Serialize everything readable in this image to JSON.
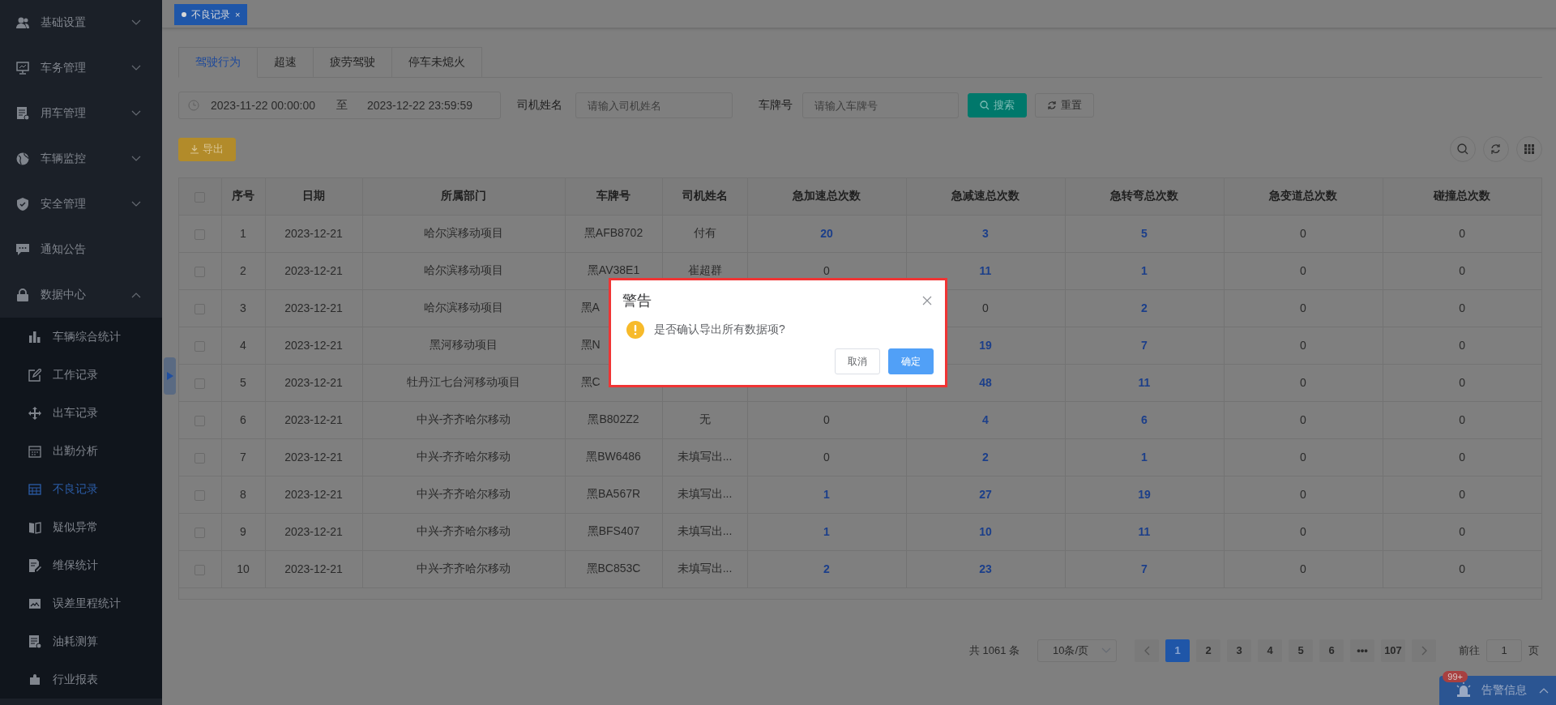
{
  "sidebar": {
    "items": [
      {
        "label": "基础设置",
        "kind": "group",
        "expanded": false
      },
      {
        "label": "车务管理",
        "kind": "group",
        "expanded": false
      },
      {
        "label": "用车管理",
        "kind": "group",
        "expanded": false
      },
      {
        "label": "车辆监控",
        "kind": "group",
        "expanded": false
      },
      {
        "label": "安全管理",
        "kind": "group",
        "expanded": false
      },
      {
        "label": "通知公告",
        "kind": "link"
      },
      {
        "label": "数据中心",
        "kind": "group",
        "expanded": true,
        "children": [
          {
            "label": "车辆综合统计",
            "selected": false
          },
          {
            "label": "工作记录",
            "selected": false
          },
          {
            "label": "出车记录",
            "selected": false
          },
          {
            "label": "出勤分析",
            "selected": false
          },
          {
            "label": "不良记录",
            "selected": true
          },
          {
            "label": "疑似异常",
            "selected": false
          },
          {
            "label": "维保统计",
            "selected": false
          },
          {
            "label": "误差里程统计",
            "selected": false
          },
          {
            "label": "油耗测算",
            "selected": false
          },
          {
            "label": "行业报表",
            "selected": false
          }
        ]
      }
    ]
  },
  "tag_bar": {
    "tags": [
      {
        "label": "不良记录",
        "close": "×",
        "selected": true
      }
    ]
  },
  "tabs": [
    {
      "label": "驾驶行为",
      "selected": true
    },
    {
      "label": "超速",
      "selected": false
    },
    {
      "label": "疲劳驾驶",
      "selected": false
    },
    {
      "label": "停车未熄火",
      "selected": false
    }
  ],
  "filters": {
    "date_start": "2023-11-22 00:00:00",
    "range_separator": "至",
    "date_end": "2023-12-22 23:59:59",
    "driver_label": "司机姓名",
    "driver_placeholder": "请输入司机姓名",
    "plate_label": "车牌号",
    "plate_placeholder": "请输入车牌号",
    "search_button": "搜索",
    "reset_button": "重置"
  },
  "toolbar": {
    "export_button": "导出"
  },
  "table": {
    "select_all_checked": false,
    "columns": [
      "序号",
      "日期",
      "所属部门",
      "车牌号",
      "司机姓名",
      "急加速总次数",
      "急减速总次数",
      "急转弯总次数",
      "急变道总次数",
      "碰撞总次数"
    ],
    "rows": [
      {
        "checked": false,
        "index": "1",
        "date": "2023-12-21",
        "dept": "哈尔滨移动项目",
        "plate": "黑AFB8702",
        "driver": "付有",
        "counts": [
          {
            "text": "20",
            "link": true
          },
          {
            "text": "3",
            "link": true
          },
          {
            "text": "5",
            "link": true
          },
          {
            "text": "0",
            "link": false
          },
          {
            "text": "0",
            "link": false
          }
        ]
      },
      {
        "checked": false,
        "index": "2",
        "date": "2023-12-21",
        "dept": "哈尔滨移动项目",
        "plate": "黑AV38E1",
        "driver": "崔超群",
        "counts": [
          {
            "text": "0",
            "link": false
          },
          {
            "text": "11",
            "link": true
          },
          {
            "text": "1",
            "link": true
          },
          {
            "text": "0",
            "link": false
          },
          {
            "text": "0",
            "link": false
          }
        ]
      },
      {
        "checked": false,
        "index": "3",
        "date": "2023-12-21",
        "dept": "哈尔滨移动项目",
        "plate": "黑A",
        "plate_cut": true,
        "first_count_hidden": true,
        "counts": [
          {
            "text": "0",
            "link": false
          },
          {
            "text": "2",
            "link": true
          },
          {
            "text": "0",
            "link": false
          },
          {
            "text": "0",
            "link": false
          }
        ]
      },
      {
        "checked": false,
        "index": "4",
        "date": "2023-12-21",
        "dept": "黑河移动项目",
        "plate": "黑N",
        "plate_cut": true,
        "first_count_hidden": true,
        "counts": [
          {
            "text": "19",
            "link": true
          },
          {
            "text": "7",
            "link": true
          },
          {
            "text": "0",
            "link": false
          },
          {
            "text": "0",
            "link": false
          }
        ]
      },
      {
        "checked": false,
        "index": "5",
        "date": "2023-12-21",
        "dept": "牡丹江七台河移动项目",
        "plate": "黑C",
        "plate_cut": true,
        "first_count_hidden": true,
        "counts": [
          {
            "text": "48",
            "link": true
          },
          {
            "text": "11",
            "link": true
          },
          {
            "text": "0",
            "link": false
          },
          {
            "text": "0",
            "link": false
          }
        ]
      },
      {
        "checked": false,
        "index": "6",
        "date": "2023-12-21",
        "dept": "中兴-齐齐哈尔移动",
        "plate": "黑B802Z2",
        "driver": "无",
        "counts": [
          {
            "text": "0",
            "link": false
          },
          {
            "text": "4",
            "link": true
          },
          {
            "text": "6",
            "link": true
          },
          {
            "text": "0",
            "link": false
          },
          {
            "text": "0",
            "link": false
          }
        ]
      },
      {
        "checked": false,
        "index": "7",
        "date": "2023-12-21",
        "dept": "中兴-齐齐哈尔移动",
        "plate": "黑BW6486",
        "driver": "未填写出...",
        "counts": [
          {
            "text": "0",
            "link": false
          },
          {
            "text": "2",
            "link": true
          },
          {
            "text": "1",
            "link": true
          },
          {
            "text": "0",
            "link": false
          },
          {
            "text": "0",
            "link": false
          }
        ]
      },
      {
        "checked": false,
        "index": "8",
        "date": "2023-12-21",
        "dept": "中兴-齐齐哈尔移动",
        "plate": "黑BA567R",
        "driver": "未填写出...",
        "counts": [
          {
            "text": "1",
            "link": true
          },
          {
            "text": "27",
            "link": true
          },
          {
            "text": "19",
            "link": true
          },
          {
            "text": "0",
            "link": false
          },
          {
            "text": "0",
            "link": false
          }
        ]
      },
      {
        "checked": false,
        "index": "9",
        "date": "2023-12-21",
        "dept": "中兴-齐齐哈尔移动",
        "plate": "黑BFS407",
        "driver": "未填写出...",
        "counts": [
          {
            "text": "1",
            "link": true
          },
          {
            "text": "10",
            "link": true
          },
          {
            "text": "11",
            "link": true
          },
          {
            "text": "0",
            "link": false
          },
          {
            "text": "0",
            "link": false
          }
        ]
      },
      {
        "checked": false,
        "index": "10",
        "date": "2023-12-21",
        "dept": "中兴-齐齐哈尔移动",
        "plate": "黑BC853C",
        "driver": "未填写出...",
        "counts": [
          {
            "text": "2",
            "link": true
          },
          {
            "text": "23",
            "link": true
          },
          {
            "text": "7",
            "link": true
          },
          {
            "text": "0",
            "link": false
          },
          {
            "text": "0",
            "link": false
          }
        ]
      }
    ]
  },
  "pagination": {
    "total": "共 1061 条",
    "page_size": "10条/页",
    "pages": [
      {
        "label": "1",
        "selected": true
      },
      {
        "label": "2",
        "selected": false
      },
      {
        "label": "3",
        "selected": false
      },
      {
        "label": "4",
        "selected": false
      },
      {
        "label": "5",
        "selected": false
      },
      {
        "label": "6",
        "selected": false
      },
      {
        "label": "•••",
        "selected": false
      },
      {
        "label": "107",
        "selected": false
      }
    ],
    "goto_label": "前往",
    "goto_value": "1",
    "page_unit": "页"
  },
  "alarm": {
    "badge": "99+",
    "label": "告警信息"
  },
  "dialog": {
    "title": "警告",
    "message": "是否确认导出所有数据项?",
    "cancel_button": "取消",
    "confirm_button": "确定"
  }
}
